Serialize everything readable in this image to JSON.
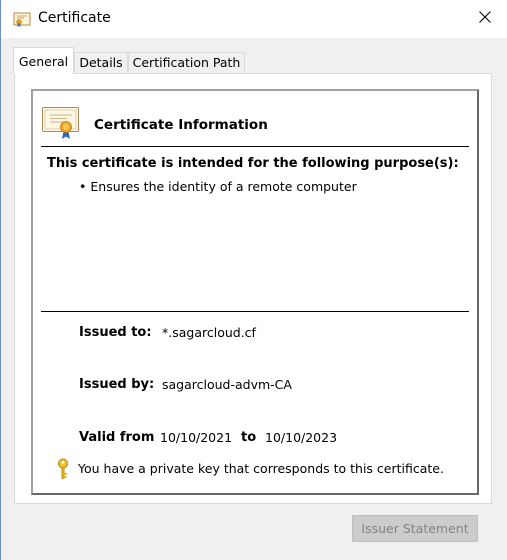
{
  "window": {
    "title": "Certificate",
    "icon": "certificate-icon",
    "close_icon": "close-icon"
  },
  "tabs": [
    {
      "label": "General",
      "active": true
    },
    {
      "label": "Details",
      "active": false
    },
    {
      "label": "Certification Path",
      "active": false
    }
  ],
  "general": {
    "heading": "Certificate Information",
    "purpose_heading": "This certificate is intended for the following purpose(s):",
    "purposes": [
      "Ensures the identity of a remote computer"
    ],
    "issued_to_label": "Issued to:",
    "issued_to_value": "*.sagarcloud.cf",
    "issued_by_label": "Issued by:",
    "issued_by_value": "sagarcloud-advm-CA",
    "valid_from_label": "Valid from",
    "valid_from_value": "10/10/2021",
    "valid_to_label": "to",
    "valid_to_value": "10/10/2023",
    "private_key_note": "You have a private key that corresponds to this certificate."
  },
  "buttons": {
    "issuer_statement": "Issuer Statement",
    "issuer_statement_enabled": false
  },
  "colors": {
    "window_border": "#6a8fc5",
    "disabled_button_bg": "#cccccc",
    "disabled_button_text": "#838383"
  }
}
